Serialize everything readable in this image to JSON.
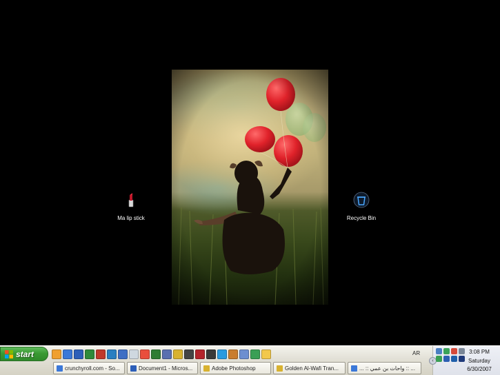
{
  "desktop": {
    "icons": [
      {
        "label": "Ma lip stick",
        "icon": "lipstick-icon"
      },
      {
        "label": "Recycle Bin",
        "icon": "recycle-bin-icon"
      }
    ],
    "wallpaper": {
      "balloon_color": "#e0222a",
      "faded_balloon_color": "#9cbf7c"
    }
  },
  "taskbar": {
    "start_label": "start",
    "quick_launch": [
      {
        "icon": "ql-orange-icon",
        "color": "#f0a030"
      },
      {
        "icon": "ie-icon",
        "color": "#3b78d8"
      },
      {
        "icon": "word-icon",
        "color": "#2d5fb8"
      },
      {
        "icon": "excel-icon",
        "color": "#2f8a3a"
      },
      {
        "icon": "access-icon",
        "color": "#c0392b"
      },
      {
        "icon": "frontpage-icon",
        "color": "#2a7fc1"
      },
      {
        "icon": "outlook-icon",
        "color": "#3f6fc4"
      },
      {
        "icon": "notepad-icon",
        "color": "#cfd8e0"
      },
      {
        "icon": "paint-icon",
        "color": "#e94e3c"
      },
      {
        "icon": "media-icon",
        "color": "#2e7d32"
      },
      {
        "icon": "photoshop-icon",
        "color": "#5a6fb0"
      },
      {
        "icon": "golden-icon",
        "color": "#d8b230"
      },
      {
        "icon": "winamp-icon",
        "color": "#444444"
      },
      {
        "icon": "opera-icon",
        "color": "#b3242b"
      },
      {
        "icon": "player-icon",
        "color": "#3a3a3a"
      },
      {
        "icon": "messenger-icon",
        "color": "#2a9be0"
      },
      {
        "icon": "person-icon",
        "color": "#c97d2e"
      },
      {
        "icon": "tool-icon",
        "color": "#6d8fd0"
      },
      {
        "icon": "network-icon",
        "color": "#3a9f55"
      },
      {
        "icon": "folder-icon",
        "color": "#f2c84b"
      }
    ],
    "language": "AR",
    "tasks": [
      {
        "label": "crunchyroll.com - So...",
        "icon": "ie-icon",
        "color": "#3b78d8"
      },
      {
        "label": "Document1 - Micros...",
        "icon": "word-icon",
        "color": "#2d5fb8"
      },
      {
        "label": "Adobe Photoshop",
        "icon": "photoshop-icon",
        "color": "#d8b230"
      },
      {
        "label": "Golden Al-Wafi Tran...",
        "icon": "golden-icon",
        "color": "#d8b230"
      },
      {
        "label": "... :: واحات بن عمي :: ...",
        "icon": "ie-icon",
        "color": "#3b78d8"
      }
    ],
    "tray": {
      "icons": [
        {
          "icon": "network-tray-icon",
          "color": "#4a7fc2"
        },
        {
          "icon": "messenger-tray-icon",
          "color": "#3aa35a"
        },
        {
          "icon": "alert-tray-icon",
          "color": "#d64a3a"
        },
        {
          "icon": "volume-tray-icon",
          "color": "#7a8798"
        },
        {
          "icon": "security-tray-icon",
          "color": "#3a9f55"
        },
        {
          "icon": "shield-tray-icon",
          "color": "#2c5fb3"
        },
        {
          "icon": "app-tray-icon",
          "color": "#1f5faa"
        },
        {
          "icon": "display-tray-icon",
          "color": "#203a7a"
        }
      ],
      "expand_glyph": "‹",
      "time": "3:08 PM",
      "day": "Saturday",
      "date": "6/30/2007"
    }
  }
}
